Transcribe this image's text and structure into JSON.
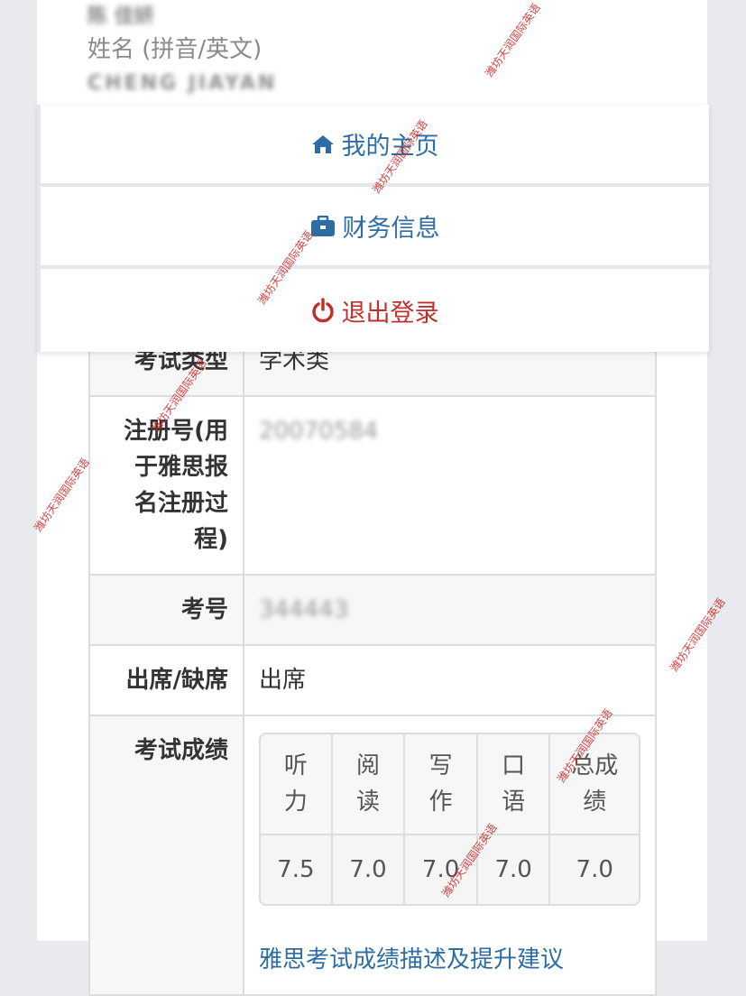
{
  "profile": {
    "name_cn": "陈 佳妍",
    "name_label": "姓名 (拼音/英文)",
    "name_en": "CHENG JIAYAN"
  },
  "menu": {
    "items": [
      {
        "label": "我的主页",
        "icon": "home-icon"
      },
      {
        "label": "财务信息",
        "icon": "briefcase-icon"
      },
      {
        "label": "退出登录",
        "icon": "power-icon"
      }
    ],
    "colors": {
      "link": "#2e6da4",
      "logout": "#c0302b"
    }
  },
  "info": {
    "exam_type_label": "考试类型",
    "exam_type_value": "学术类",
    "reg_label_lines": [
      "注册号(用",
      "于雅思报",
      "名注册过",
      "程)"
    ],
    "reg_value": "20070584",
    "candidate_label": "考号",
    "candidate_value": "344443",
    "attendance_label": "出席/缺席",
    "attendance_value": "出席",
    "scores_label": "考试成绩"
  },
  "scores": {
    "headers": [
      [
        "听",
        "力"
      ],
      [
        "阅",
        "读"
      ],
      [
        "写",
        "作"
      ],
      [
        "口",
        "语"
      ],
      [
        "总成",
        "绩"
      ]
    ],
    "values": [
      "7.5",
      "7.0",
      "7.0",
      "7.0",
      "7.0"
    ],
    "link_text": "雅思考试成绩描述及提升建议"
  },
  "watermark": "潍坊天润国际英语"
}
